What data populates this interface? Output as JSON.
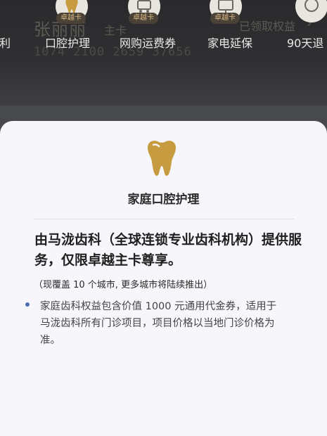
{
  "background": {
    "member_name": "张丽丽",
    "card_tier": "主卡",
    "card_number": "1074 2100 2659 37656",
    "claimed_link": "已领取权益"
  },
  "benefits": [
    {
      "label": "利",
      "badge": "",
      "icon": "partial-icon"
    },
    {
      "label": "口腔护理",
      "badge": "卓越卡",
      "icon": "tooth-icon"
    },
    {
      "label": "网购运费券",
      "badge": "卓越卡",
      "icon": "shopping-icon"
    },
    {
      "label": "家电延保",
      "badge": "卓越卡",
      "icon": "appliance-icon"
    },
    {
      "label": "90天退",
      "badge": "",
      "icon": "return-icon"
    }
  ],
  "modal": {
    "title": "家庭口腔护理",
    "headline": "由马泷齿科（全球连锁专业齿科机构）提供服务，仅限卓越主卡尊享。",
    "note": "（现覆盖 10 个城市, 更多城市将陆续推出）",
    "bullet": "家庭齿科权益包含价值 1000 元通用代金券，适用于马泷齿科所有门诊项目，项目价格以当地门诊价格为准。"
  },
  "colors": {
    "accent_gold": "#c79b3f",
    "badge_bg": "#4b4237",
    "bullet_blue": "#4a6fb0"
  }
}
